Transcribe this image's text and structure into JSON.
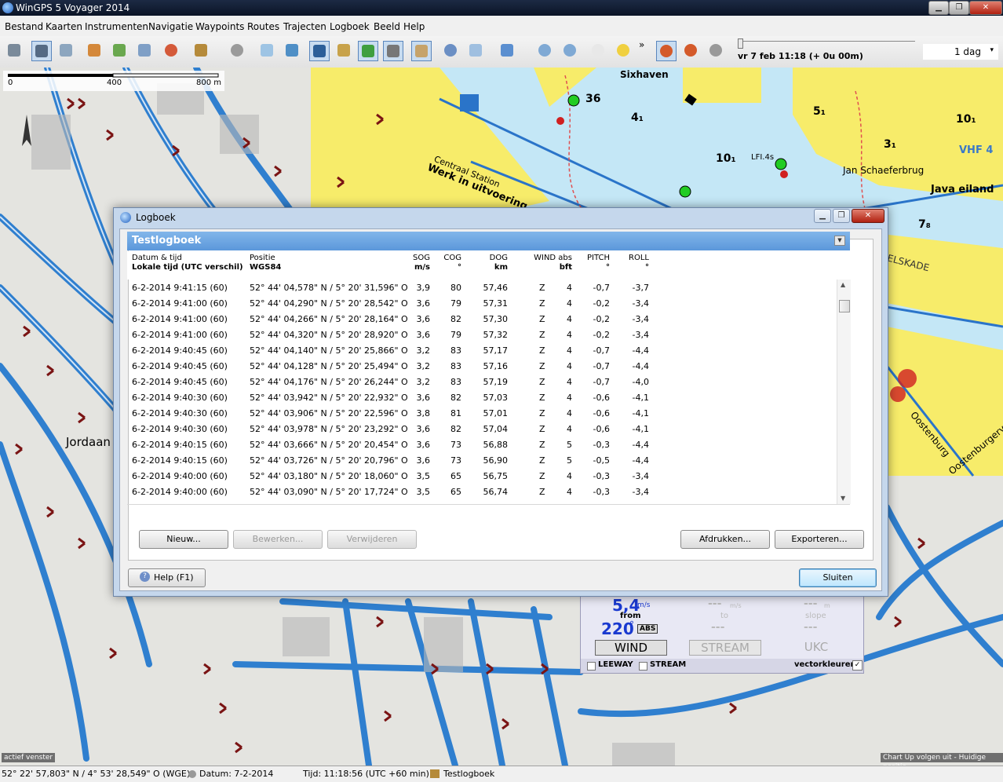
{
  "window": {
    "title": "WinGPS 5 Voyager 2014"
  },
  "menu": [
    "Bestand",
    "Kaarten",
    "Instrumenten",
    "Navigatie",
    "Waypoints",
    "Routes",
    "Trajecten",
    "Logboek",
    "Beeld",
    "Help"
  ],
  "toolbar": {
    "time_display": "vr 7 feb 11:18  (+ 0u 00m)",
    "period_select": "1 dag",
    "overflow": "»"
  },
  "map": {
    "scale": {
      "labels": [
        "0",
        "400",
        "800 m"
      ]
    },
    "labels": {
      "sixhaven": "Sixhaven",
      "werk": "Werk in uitvoering",
      "centraal": "Centraal Station",
      "java": "Java eiland",
      "brug": "Jan Schaeferbrug",
      "vhf": "VHF 4",
      "elskade": "ELSKADE",
      "oostenburg": "Oostenburg",
      "oostenburgerv": "Oostenburgerv",
      "jordaan": "Jordaan",
      "lfi": "LFI.4s",
      "depth_10a": "10₁",
      "depth_10b": "10₁",
      "depth_5": "5₁",
      "depth_4": "4₁",
      "depth_3": "3₁",
      "depth_7": "7₈",
      "depth_36": "36"
    },
    "bottom_left_label": "actief venster",
    "bottom_right_label": "Chart Up volgen uit - Huidige positie"
  },
  "dialog": {
    "title": "Logboek",
    "panel_title": "Testlogboek",
    "columns": [
      {
        "top": "Datum & tijd",
        "bottom": "Lokale tijd (UTC verschil)"
      },
      {
        "top": "Positie",
        "bottom": "WGS84"
      },
      {
        "top": "SOG",
        "bottom": "m/s"
      },
      {
        "top": "COG",
        "bottom": "°"
      },
      {
        "top": "DOG",
        "bottom": "km"
      },
      {
        "top": "WIND abs",
        "bottom": "bft"
      },
      {
        "top": "PITCH",
        "bottom": "°"
      },
      {
        "top": "ROLL",
        "bottom": "°"
      }
    ],
    "rows": [
      [
        "6-2-2014 9:41:15 (60)",
        "52° 44' 04,578\" N / 5° 20' 31,596\" O",
        "3,9",
        "80",
        "57,46",
        "Z",
        "4",
        "-0,7",
        "-3,7"
      ],
      [
        "6-2-2014 9:41:00 (60)",
        "52° 44' 04,290\" N / 5° 20' 28,542\" O",
        "3,6",
        "79",
        "57,31",
        "Z",
        "4",
        "-0,2",
        "-3,4"
      ],
      [
        "6-2-2014 9:41:00 (60)",
        "52° 44' 04,266\" N / 5° 20' 28,164\" O",
        "3,6",
        "82",
        "57,30",
        "Z",
        "4",
        "-0,2",
        "-3,4"
      ],
      [
        "6-2-2014 9:41:00 (60)",
        "52° 44' 04,320\" N / 5° 20' 28,920\" O",
        "3,6",
        "79",
        "57,32",
        "Z",
        "4",
        "-0,2",
        "-3,4"
      ],
      [
        "6-2-2014 9:40:45 (60)",
        "52° 44' 04,140\" N / 5° 20' 25,866\" O",
        "3,2",
        "83",
        "57,17",
        "Z",
        "4",
        "-0,7",
        "-4,4"
      ],
      [
        "6-2-2014 9:40:45 (60)",
        "52° 44' 04,128\" N / 5° 20' 25,494\" O",
        "3,2",
        "83",
        "57,16",
        "Z",
        "4",
        "-0,7",
        "-4,4"
      ],
      [
        "6-2-2014 9:40:45 (60)",
        "52° 44' 04,176\" N / 5° 20' 26,244\" O",
        "3,2",
        "83",
        "57,19",
        "Z",
        "4",
        "-0,7",
        "-4,0"
      ],
      [
        "6-2-2014 9:40:30 (60)",
        "52° 44' 03,942\" N / 5° 20' 22,932\" O",
        "3,6",
        "82",
        "57,03",
        "Z",
        "4",
        "-0,6",
        "-4,1"
      ],
      [
        "6-2-2014 9:40:30 (60)",
        "52° 44' 03,906\" N / 5° 20' 22,596\" O",
        "3,8",
        "81",
        "57,01",
        "Z",
        "4",
        "-0,6",
        "-4,1"
      ],
      [
        "6-2-2014 9:40:30 (60)",
        "52° 44' 03,978\" N / 5° 20' 23,292\" O",
        "3,6",
        "82",
        "57,04",
        "Z",
        "4",
        "-0,6",
        "-4,1"
      ],
      [
        "6-2-2014 9:40:15 (60)",
        "52° 44' 03,666\" N / 5° 20' 20,454\" O",
        "3,6",
        "73",
        "56,88",
        "Z",
        "5",
        "-0,3",
        "-4,4"
      ],
      [
        "6-2-2014 9:40:15 (60)",
        "52° 44' 03,726\" N / 5° 20' 20,796\" O",
        "3,6",
        "73",
        "56,90",
        "Z",
        "5",
        "-0,5",
        "-4,4"
      ],
      [
        "6-2-2014 9:40:00 (60)",
        "52° 44' 03,180\" N / 5° 20' 18,060\" O",
        "3,5",
        "65",
        "56,75",
        "Z",
        "4",
        "-0,3",
        "-3,4"
      ],
      [
        "6-2-2014 9:40:00 (60)",
        "52° 44' 03,090\" N / 5° 20' 17,724\" O",
        "3,5",
        "65",
        "56,74",
        "Z",
        "4",
        "-0,3",
        "-3,4"
      ]
    ],
    "buttons": {
      "new": "Nieuw...",
      "edit": "Bewerken...",
      "delete": "Verwijderen",
      "print": "Afdrukken...",
      "export": "Exporteren...",
      "help": "Help (F1)",
      "close": "Sluiten"
    }
  },
  "wind_panel": {
    "speed": "5,4",
    "speed_unit": "m/s",
    "from": "from",
    "direction": "220",
    "degree": "°",
    "abs": "ABS",
    "dash1": "---",
    "dash1_unit": "m/s",
    "to": "to",
    "dash2": "---",
    "dash3": "---",
    "dash3_unit": "m",
    "slope": "slope",
    "dash4": "---",
    "btn_wind": "WIND",
    "btn_stream": "STREAM",
    "btn_ukc": "UKC",
    "leeway": "LEEWAY",
    "stream": "STREAM",
    "vector": "vectorkleuren",
    "check": "✓"
  },
  "status": {
    "position": "52° 22' 57,803\" N / 4° 53' 28,549\" O (WGE)",
    "date": "Datum: 7-2-2014",
    "time": "Tijd: 11:18:56 (UTC +60 min)",
    "logbook": "Testlogboek"
  },
  "colors": {
    "water": "#bfe6f7",
    "land": "#e6e6e2",
    "chart_land": "#f9ee6b",
    "canal": "#2f7fcf",
    "bridge": "#7a1414",
    "dialog_frame": "#c5d7ec",
    "panel_header": "#5b97da"
  }
}
